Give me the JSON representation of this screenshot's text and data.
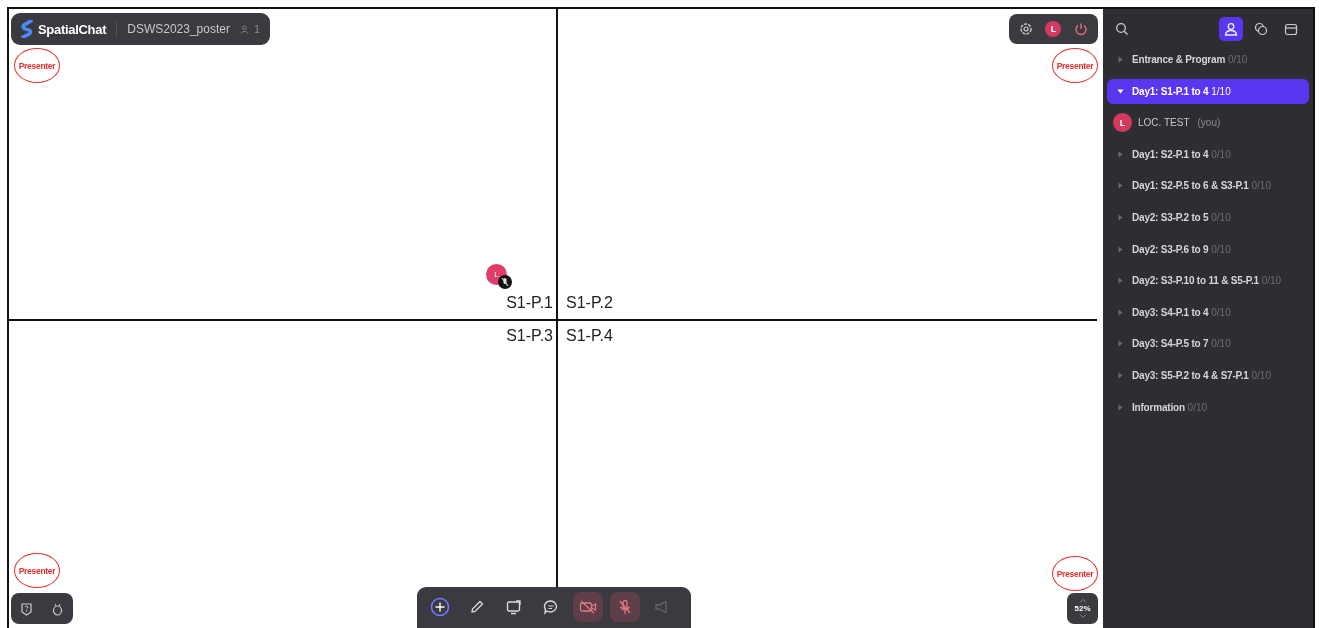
{
  "header": {
    "app_name": "SpatialChat",
    "room": "DSWS2023_poster",
    "participants": "1"
  },
  "top_controls": {
    "avatar": "L"
  },
  "presenter_marks": [
    {
      "label": "Presenter"
    },
    {
      "label": "Presenter"
    },
    {
      "label": "Presenter"
    },
    {
      "label": "Presenter"
    }
  ],
  "zones": [
    {
      "label": "S1-P.1"
    },
    {
      "label": "S1-P.2"
    },
    {
      "label": "S1-P.3"
    },
    {
      "label": "S1-P.4"
    }
  ],
  "canvas_user": {
    "initial": "L",
    "muted": true
  },
  "toolbar": [
    {
      "kind": "add",
      "on": true
    },
    {
      "kind": "pen",
      "on": true
    },
    {
      "kind": "screen",
      "on": true
    },
    {
      "kind": "chat",
      "on": true
    },
    {
      "kind": "camera",
      "on": false
    },
    {
      "kind": "mic",
      "on": false
    },
    {
      "kind": "megaphone",
      "on": false
    }
  ],
  "zoom": "52%",
  "sidebar": {
    "tabs": [
      {
        "kind": "people",
        "selected": true
      },
      {
        "kind": "chat",
        "selected": false
      },
      {
        "kind": "calendar",
        "selected": false
      }
    ],
    "rooms": [
      {
        "name": "Entrance & Program",
        "count": "0/10",
        "expanded": false,
        "selected": false
      },
      {
        "name": "Day1: S1-P.1 to 4",
        "count": "1/10",
        "expanded": true,
        "selected": true,
        "members": [
          {
            "initial": "L",
            "name": "LOC. TEST",
            "note": "(you)"
          }
        ]
      },
      {
        "name": "Day1: S2-P.1 to 4",
        "count": "0/10",
        "expanded": false,
        "selected": false
      },
      {
        "name": "Day1: S2-P.5 to 6 & S3-P.1",
        "count": "0/10",
        "expanded": false,
        "selected": false
      },
      {
        "name": "Day2: S3-P.2 to 5",
        "count": "0/10",
        "expanded": false,
        "selected": false
      },
      {
        "name": "Day2: S3-P.6 to 9",
        "count": "0/10",
        "expanded": false,
        "selected": false
      },
      {
        "name": "Day2: S3-P.10 to 11 & S5-P.1",
        "count": "0/10",
        "expanded": false,
        "selected": false
      },
      {
        "name": "Day3: S4-P.1 to 4",
        "count": "0/10",
        "expanded": false,
        "selected": false
      },
      {
        "name": "Day3: S4-P.5 to 7",
        "count": "0/10",
        "expanded": false,
        "selected": false
      },
      {
        "name": "Day3: S5-P.2 to 4 & S7-P.1",
        "count": "0/10",
        "expanded": false,
        "selected": false
      },
      {
        "name": "Information",
        "count": "0/10",
        "expanded": false,
        "selected": false
      }
    ]
  }
}
